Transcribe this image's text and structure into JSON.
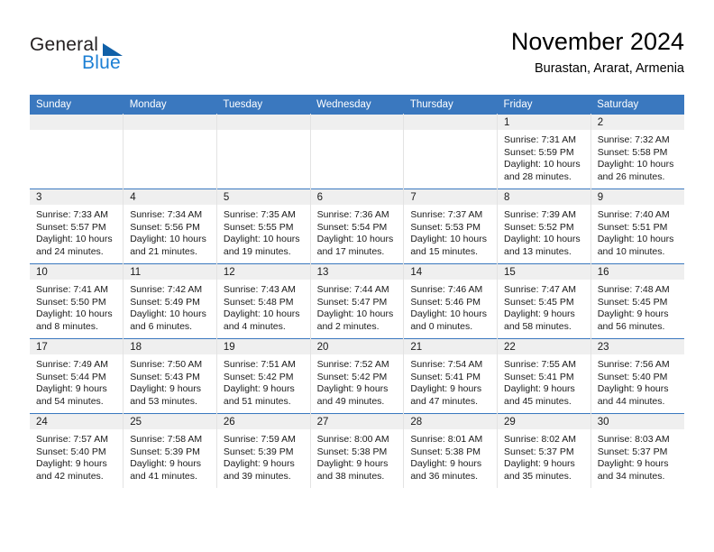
{
  "brand": {
    "name_part1": "General",
    "name_part2": "Blue",
    "flag_icon": "blue-triangle-flag-icon",
    "accent_color": "#1c7fd4"
  },
  "header": {
    "title": "November 2024",
    "subtitle": "Burastan, Ararat, Armenia"
  },
  "calendar": {
    "header_color": "#3a78bf",
    "daynum_bar_color": "#efefef",
    "weekday_headers": [
      "Sunday",
      "Monday",
      "Tuesday",
      "Wednesday",
      "Thursday",
      "Friday",
      "Saturday"
    ],
    "weeks": [
      [
        {
          "day": "",
          "sunrise": "",
          "sunset": "",
          "daylight_line1": "",
          "daylight_line2": "",
          "empty": true
        },
        {
          "day": "",
          "sunrise": "",
          "sunset": "",
          "daylight_line1": "",
          "daylight_line2": "",
          "empty": true
        },
        {
          "day": "",
          "sunrise": "",
          "sunset": "",
          "daylight_line1": "",
          "daylight_line2": "",
          "empty": true
        },
        {
          "day": "",
          "sunrise": "",
          "sunset": "",
          "daylight_line1": "",
          "daylight_line2": "",
          "empty": true
        },
        {
          "day": "",
          "sunrise": "",
          "sunset": "",
          "daylight_line1": "",
          "daylight_line2": "",
          "empty": true
        },
        {
          "day": "1",
          "sunrise": "Sunrise: 7:31 AM",
          "sunset": "Sunset: 5:59 PM",
          "daylight_line1": "Daylight: 10 hours",
          "daylight_line2": "and 28 minutes.",
          "empty": false
        },
        {
          "day": "2",
          "sunrise": "Sunrise: 7:32 AM",
          "sunset": "Sunset: 5:58 PM",
          "daylight_line1": "Daylight: 10 hours",
          "daylight_line2": "and 26 minutes.",
          "empty": false
        }
      ],
      [
        {
          "day": "3",
          "sunrise": "Sunrise: 7:33 AM",
          "sunset": "Sunset: 5:57 PM",
          "daylight_line1": "Daylight: 10 hours",
          "daylight_line2": "and 24 minutes.",
          "empty": false
        },
        {
          "day": "4",
          "sunrise": "Sunrise: 7:34 AM",
          "sunset": "Sunset: 5:56 PM",
          "daylight_line1": "Daylight: 10 hours",
          "daylight_line2": "and 21 minutes.",
          "empty": false
        },
        {
          "day": "5",
          "sunrise": "Sunrise: 7:35 AM",
          "sunset": "Sunset: 5:55 PM",
          "daylight_line1": "Daylight: 10 hours",
          "daylight_line2": "and 19 minutes.",
          "empty": false
        },
        {
          "day": "6",
          "sunrise": "Sunrise: 7:36 AM",
          "sunset": "Sunset: 5:54 PM",
          "daylight_line1": "Daylight: 10 hours",
          "daylight_line2": "and 17 minutes.",
          "empty": false
        },
        {
          "day": "7",
          "sunrise": "Sunrise: 7:37 AM",
          "sunset": "Sunset: 5:53 PM",
          "daylight_line1": "Daylight: 10 hours",
          "daylight_line2": "and 15 minutes.",
          "empty": false
        },
        {
          "day": "8",
          "sunrise": "Sunrise: 7:39 AM",
          "sunset": "Sunset: 5:52 PM",
          "daylight_line1": "Daylight: 10 hours",
          "daylight_line2": "and 13 minutes.",
          "empty": false
        },
        {
          "day": "9",
          "sunrise": "Sunrise: 7:40 AM",
          "sunset": "Sunset: 5:51 PM",
          "daylight_line1": "Daylight: 10 hours",
          "daylight_line2": "and 10 minutes.",
          "empty": false
        }
      ],
      [
        {
          "day": "10",
          "sunrise": "Sunrise: 7:41 AM",
          "sunset": "Sunset: 5:50 PM",
          "daylight_line1": "Daylight: 10 hours",
          "daylight_line2": "and 8 minutes.",
          "empty": false
        },
        {
          "day": "11",
          "sunrise": "Sunrise: 7:42 AM",
          "sunset": "Sunset: 5:49 PM",
          "daylight_line1": "Daylight: 10 hours",
          "daylight_line2": "and 6 minutes.",
          "empty": false
        },
        {
          "day": "12",
          "sunrise": "Sunrise: 7:43 AM",
          "sunset": "Sunset: 5:48 PM",
          "daylight_line1": "Daylight: 10 hours",
          "daylight_line2": "and 4 minutes.",
          "empty": false
        },
        {
          "day": "13",
          "sunrise": "Sunrise: 7:44 AM",
          "sunset": "Sunset: 5:47 PM",
          "daylight_line1": "Daylight: 10 hours",
          "daylight_line2": "and 2 minutes.",
          "empty": false
        },
        {
          "day": "14",
          "sunrise": "Sunrise: 7:46 AM",
          "sunset": "Sunset: 5:46 PM",
          "daylight_line1": "Daylight: 10 hours",
          "daylight_line2": "and 0 minutes.",
          "empty": false
        },
        {
          "day": "15",
          "sunrise": "Sunrise: 7:47 AM",
          "sunset": "Sunset: 5:45 PM",
          "daylight_line1": "Daylight: 9 hours",
          "daylight_line2": "and 58 minutes.",
          "empty": false
        },
        {
          "day": "16",
          "sunrise": "Sunrise: 7:48 AM",
          "sunset": "Sunset: 5:45 PM",
          "daylight_line1": "Daylight: 9 hours",
          "daylight_line2": "and 56 minutes.",
          "empty": false
        }
      ],
      [
        {
          "day": "17",
          "sunrise": "Sunrise: 7:49 AM",
          "sunset": "Sunset: 5:44 PM",
          "daylight_line1": "Daylight: 9 hours",
          "daylight_line2": "and 54 minutes.",
          "empty": false
        },
        {
          "day": "18",
          "sunrise": "Sunrise: 7:50 AM",
          "sunset": "Sunset: 5:43 PM",
          "daylight_line1": "Daylight: 9 hours",
          "daylight_line2": "and 53 minutes.",
          "empty": false
        },
        {
          "day": "19",
          "sunrise": "Sunrise: 7:51 AM",
          "sunset": "Sunset: 5:42 PM",
          "daylight_line1": "Daylight: 9 hours",
          "daylight_line2": "and 51 minutes.",
          "empty": false
        },
        {
          "day": "20",
          "sunrise": "Sunrise: 7:52 AM",
          "sunset": "Sunset: 5:42 PM",
          "daylight_line1": "Daylight: 9 hours",
          "daylight_line2": "and 49 minutes.",
          "empty": false
        },
        {
          "day": "21",
          "sunrise": "Sunrise: 7:54 AM",
          "sunset": "Sunset: 5:41 PM",
          "daylight_line1": "Daylight: 9 hours",
          "daylight_line2": "and 47 minutes.",
          "empty": false
        },
        {
          "day": "22",
          "sunrise": "Sunrise: 7:55 AM",
          "sunset": "Sunset: 5:41 PM",
          "daylight_line1": "Daylight: 9 hours",
          "daylight_line2": "and 45 minutes.",
          "empty": false
        },
        {
          "day": "23",
          "sunrise": "Sunrise: 7:56 AM",
          "sunset": "Sunset: 5:40 PM",
          "daylight_line1": "Daylight: 9 hours",
          "daylight_line2": "and 44 minutes.",
          "empty": false
        }
      ],
      [
        {
          "day": "24",
          "sunrise": "Sunrise: 7:57 AM",
          "sunset": "Sunset: 5:40 PM",
          "daylight_line1": "Daylight: 9 hours",
          "daylight_line2": "and 42 minutes.",
          "empty": false
        },
        {
          "day": "25",
          "sunrise": "Sunrise: 7:58 AM",
          "sunset": "Sunset: 5:39 PM",
          "daylight_line1": "Daylight: 9 hours",
          "daylight_line2": "and 41 minutes.",
          "empty": false
        },
        {
          "day": "26",
          "sunrise": "Sunrise: 7:59 AM",
          "sunset": "Sunset: 5:39 PM",
          "daylight_line1": "Daylight: 9 hours",
          "daylight_line2": "and 39 minutes.",
          "empty": false
        },
        {
          "day": "27",
          "sunrise": "Sunrise: 8:00 AM",
          "sunset": "Sunset: 5:38 PM",
          "daylight_line1": "Daylight: 9 hours",
          "daylight_line2": "and 38 minutes.",
          "empty": false
        },
        {
          "day": "28",
          "sunrise": "Sunrise: 8:01 AM",
          "sunset": "Sunset: 5:38 PM",
          "daylight_line1": "Daylight: 9 hours",
          "daylight_line2": "and 36 minutes.",
          "empty": false
        },
        {
          "day": "29",
          "sunrise": "Sunrise: 8:02 AM",
          "sunset": "Sunset: 5:37 PM",
          "daylight_line1": "Daylight: 9 hours",
          "daylight_line2": "and 35 minutes.",
          "empty": false
        },
        {
          "day": "30",
          "sunrise": "Sunrise: 8:03 AM",
          "sunset": "Sunset: 5:37 PM",
          "daylight_line1": "Daylight: 9 hours",
          "daylight_line2": "and 34 minutes.",
          "empty": false
        }
      ]
    ]
  }
}
